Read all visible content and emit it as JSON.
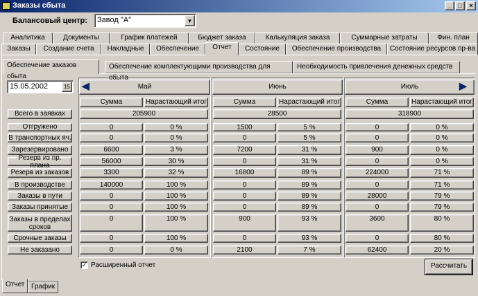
{
  "window": {
    "title": "Заказы сбыта",
    "btn_min": "_",
    "btn_max": "□",
    "btn_close": "×"
  },
  "balance_center": {
    "label": "Балансовый центр:",
    "value": "Завод \"А\"",
    "dropdown_glyph": "▼"
  },
  "tabs_row1": [
    "Аналитика",
    "Документы",
    "График платежей",
    "Бюджет заказа",
    "Калькуляция заказа",
    "Суммарные затраты",
    "Фин. план"
  ],
  "tabs_row2": [
    "Заказы",
    "Создание счета",
    "Накладные",
    "Обеспечение",
    "Отчет",
    "Состояние",
    "Обеспечение производства",
    "Состояние ресурсов пр-ва"
  ],
  "active_tab": "Отчет",
  "subtabs": [
    "Обеспечение заказов сбыта",
    "Обеспечение комплектующими производства для сбыта",
    "Необходимость привлечения денежных средств"
  ],
  "active_subtab": "Обеспечение заказов сбыта",
  "date": {
    "value": "15.05.2002",
    "calendar_glyph": "15"
  },
  "nav": {
    "prev": "◀",
    "next": "▶"
  },
  "col_headers": {
    "sum": "Сумма",
    "cumulative": "Нарастающий итог"
  },
  "row_labels": [
    "Всего в заявках",
    "Отгружено",
    "В транспортных яч.",
    "Зарезервировано",
    "Резерв из пр. плана",
    "Резерв из заказов",
    "В производстве",
    "Заказы в пути",
    "Заказы принятые",
    "Заказы в пределах сроков",
    "Срочные заказы",
    "Не заказано"
  ],
  "months": [
    {
      "name": "Май",
      "total": "205900",
      "rows": [
        [
          "0",
          "0 %"
        ],
        [
          "0",
          "0 %"
        ],
        [
          "6600",
          "3 %"
        ],
        [
          "56000",
          "30 %"
        ],
        [
          "3300",
          "32 %"
        ],
        [
          "140000",
          "100 %"
        ],
        [
          "0",
          "100 %"
        ],
        [
          "0",
          "100 %"
        ],
        [
          "0",
          "100 %"
        ],
        [
          "0",
          "100 %"
        ],
        [
          "0",
          "0 %"
        ]
      ]
    },
    {
      "name": "Июнь",
      "total": "28500",
      "rows": [
        [
          "1500",
          "5 %"
        ],
        [
          "0",
          "5 %"
        ],
        [
          "7200",
          "31 %"
        ],
        [
          "0",
          "31 %"
        ],
        [
          "16800",
          "89 %"
        ],
        [
          "0",
          "89 %"
        ],
        [
          "0",
          "89 %"
        ],
        [
          "0",
          "89 %"
        ],
        [
          "900",
          "93 %"
        ],
        [
          "0",
          "93 %"
        ],
        [
          "2100",
          "7 %"
        ]
      ]
    },
    {
      "name": "Июль",
      "total": "318900",
      "rows": [
        [
          "0",
          "0 %"
        ],
        [
          "0",
          "0 %"
        ],
        [
          "900",
          "0 %"
        ],
        [
          "0",
          "0 %"
        ],
        [
          "224000",
          "71 %"
        ],
        [
          "0",
          "71 %"
        ],
        [
          "28000",
          "79 %"
        ],
        [
          "0",
          "79 %"
        ],
        [
          "3600",
          "80 %"
        ],
        [
          "0",
          "80 %"
        ],
        [
          "62400",
          "20 %"
        ]
      ]
    }
  ],
  "extended_report": {
    "label": "Расширенный отчет",
    "checked": true,
    "check_glyph": "✓"
  },
  "calc_button": "Рассчитать",
  "bottom_tabs": [
    "Отчет",
    "График"
  ]
}
